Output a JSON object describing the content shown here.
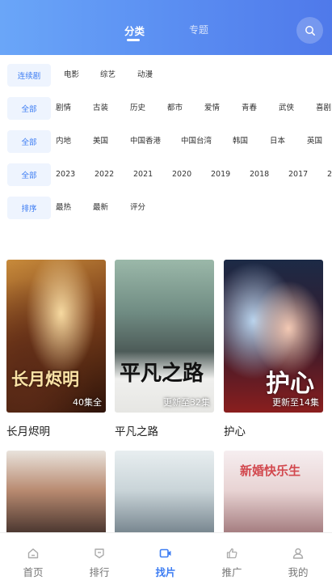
{
  "header": {
    "tabs": [
      {
        "label": "分类",
        "active": true
      },
      {
        "label": "专题",
        "active": false
      }
    ],
    "search_icon": "search-icon",
    "accent_color": "#5b8ff2"
  },
  "filters": [
    {
      "chip": "连续剧",
      "options": [
        "电影",
        "综艺",
        "动漫"
      ]
    },
    {
      "chip": "全部",
      "options": [
        "剧情",
        "古装",
        "历史",
        "都市",
        "爱情",
        "青春",
        "武侠",
        "喜剧"
      ]
    },
    {
      "chip": "全部",
      "options": [
        "内地",
        "美国",
        "中国香港",
        "中国台湾",
        "韩国",
        "日本",
        "英国"
      ]
    },
    {
      "chip": "全部",
      "options": [
        "2023",
        "2022",
        "2021",
        "2020",
        "2019",
        "2018",
        "2017",
        "2"
      ]
    },
    {
      "chip": "排序",
      "options": [
        "最热",
        "最新",
        "评分"
      ]
    }
  ],
  "cards": [
    {
      "title": "长月烬明",
      "badge": "40集全",
      "poster_text": "长月烬明"
    },
    {
      "title": "平凡之路",
      "badge": "更新至32集",
      "poster_text": "平凡之路"
    },
    {
      "title": "护心",
      "badge": "更新至14集",
      "poster_text": "护心"
    },
    {
      "title": "",
      "badge": "",
      "poster_text": ""
    },
    {
      "title": "",
      "badge": "",
      "poster_text": ""
    },
    {
      "title": "",
      "badge": "",
      "poster_text": "新婚快乐生"
    }
  ],
  "bottom_nav": [
    {
      "label": "首页",
      "icon": "home-icon",
      "active": false
    },
    {
      "label": "排行",
      "icon": "ranking-icon",
      "active": false
    },
    {
      "label": "找片",
      "icon": "video-icon",
      "active": true
    },
    {
      "label": "推广",
      "icon": "thumbs-up-icon",
      "active": false
    },
    {
      "label": "我的",
      "icon": "user-icon",
      "active": false
    }
  ]
}
